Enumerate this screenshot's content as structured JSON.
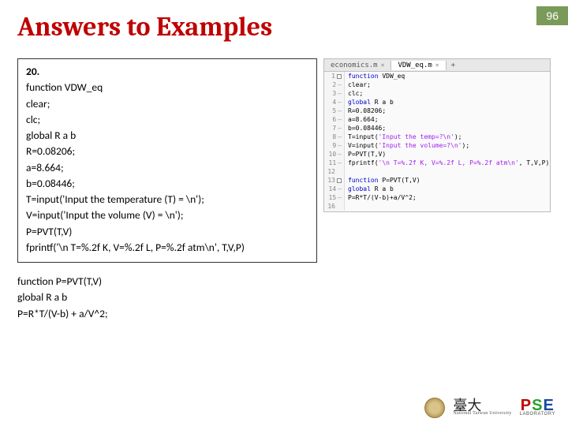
{
  "page_number": "96",
  "title": "Answers to Examples",
  "example_number": "20.",
  "code_main": [
    "function VDW_eq",
    "clear;",
    "clc;",
    "global R a b",
    "R=0.08206;",
    "a=8.664;",
    "b=0.08446;",
    "T=input('Input the temperature (T) = \\n');",
    "V=input('Input the volume (V) = \\n');",
    "P=PVT(T,V)",
    "fprintf('\\n T=%.2f K, V=%.2f L, P=%.2f atm\\n', T,V,P)"
  ],
  "code_func": [
    "function P=PVT(T,V)",
    "global R a b",
    "P=R*T/(V-b) + a/V^2;"
  ],
  "editor": {
    "tabs": [
      {
        "label": "economics.m",
        "active": false
      },
      {
        "label": "VDW_eq.m",
        "active": true
      }
    ],
    "lines": [
      {
        "n": "1",
        "fold": "sq",
        "html": "<span class='k-blue'>function</span> VDW_eq"
      },
      {
        "n": "2",
        "fold": "dash",
        "html": "clear;"
      },
      {
        "n": "3",
        "fold": "dash",
        "html": "clc;"
      },
      {
        "n": "4",
        "fold": "dash",
        "html": "<span class='k-blue'>global</span> R a b"
      },
      {
        "n": "5",
        "fold": "dash",
        "html": "R=0.08206;"
      },
      {
        "n": "6",
        "fold": "dash",
        "html": "a=8.664;"
      },
      {
        "n": "7",
        "fold": "dash",
        "html": "b=0.08446;"
      },
      {
        "n": "8",
        "fold": "dash",
        "html": "T=input(<span class='k-pur'>'Input the temp=?\\n'</span>);"
      },
      {
        "n": "9",
        "fold": "dash",
        "html": "V=input(<span class='k-pur'>'Input the volume=?\\n'</span>);"
      },
      {
        "n": "10",
        "fold": "dash",
        "html": "P=PVT(T,V)"
      },
      {
        "n": "11",
        "fold": "dash",
        "html": "fprintf(<span class='k-pur'>'\\n T=%.2f K, V=%.2f L, P=%.2f atm\\n'</span>, T,V,P)"
      },
      {
        "n": "12",
        "fold": "",
        "html": ""
      },
      {
        "n": "13",
        "fold": "sq",
        "html": "<span class='k-blue'>function</span> P=PVT(T,V)"
      },
      {
        "n": "14",
        "fold": "dash",
        "html": "<span class='k-blue'>global</span> R a b"
      },
      {
        "n": "15",
        "fold": "dash",
        "html": "P=R*T/(V-b)+a/V^2;"
      },
      {
        "n": "16",
        "fold": "",
        "html": ""
      }
    ]
  },
  "footer": {
    "uni_char": "臺大",
    "uni_sub": "National Taiwan University",
    "pse": {
      "p": "P",
      "s": "S",
      "e": "E",
      "sub": "LABORATORY"
    }
  }
}
